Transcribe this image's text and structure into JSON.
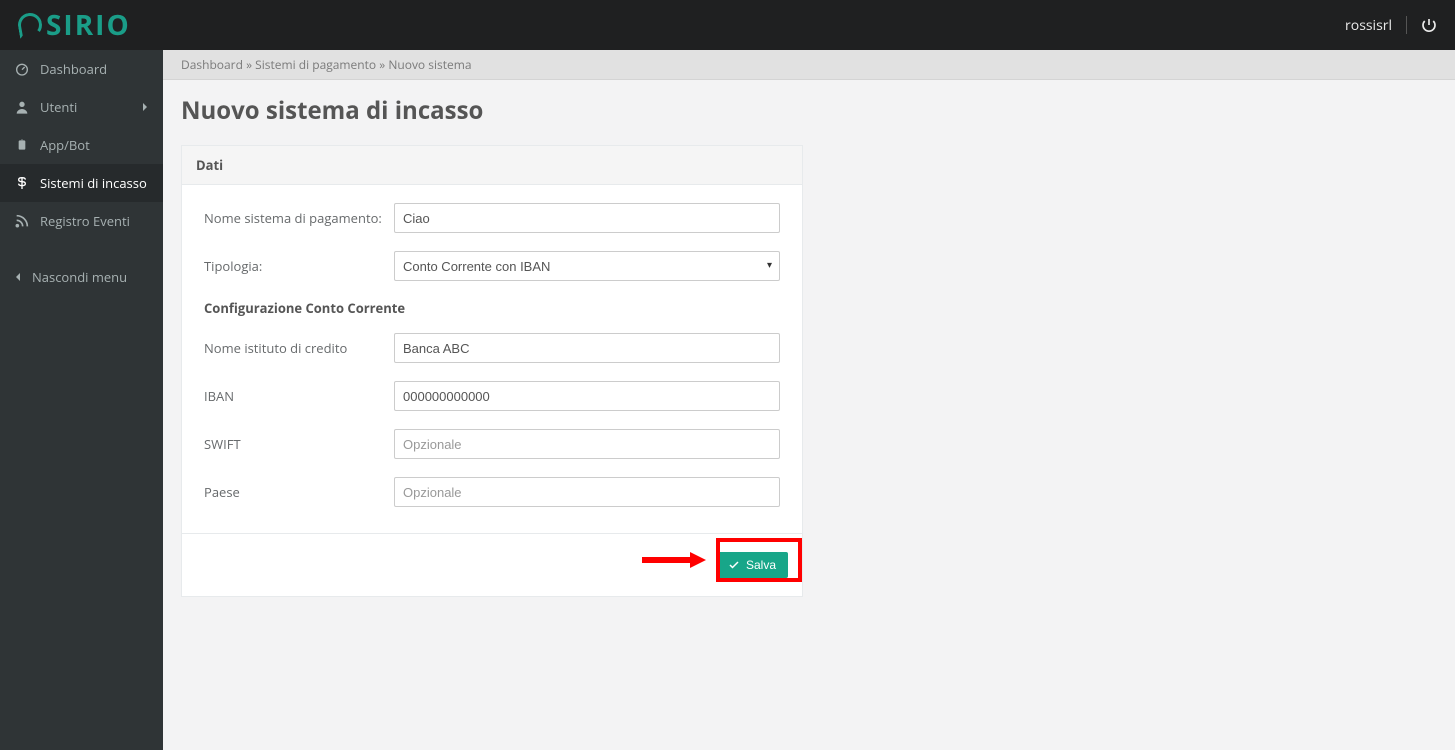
{
  "header": {
    "logo_text": "SIRIO",
    "username": "rossisrl"
  },
  "sidebar": {
    "items": [
      {
        "label": "Dashboard",
        "icon": "dashboard-icon"
      },
      {
        "label": "Utenti",
        "icon": "user-icon",
        "expandable": true
      },
      {
        "label": "App/Bot",
        "icon": "appbot-icon"
      },
      {
        "label": "Sistemi di incasso",
        "icon": "dollar-icon",
        "active": true
      },
      {
        "label": "Registro Eventi",
        "icon": "rss-icon"
      }
    ],
    "hide_label": "Nascondi menu"
  },
  "breadcrumb": {
    "part1": "Dashboard",
    "sep": " » ",
    "part2": "Sistemi di pagamento",
    "part3": "Nuovo sistema"
  },
  "page": {
    "title": "Nuovo sistema di incasso"
  },
  "form": {
    "card_title": "Dati",
    "name_label": "Nome sistema di pagamento:",
    "name_value": "Ciao",
    "type_label": "Tipologia:",
    "type_value": "Conto Corrente con IBAN",
    "section_label": "Configurazione Conto Corrente",
    "bank_label": "Nome istituto di credito",
    "bank_value": "Banca ABC",
    "iban_label": "IBAN",
    "iban_value": "000000000000",
    "swift_label": "SWIFT",
    "swift_placeholder": "Opzionale",
    "country_label": "Paese",
    "country_placeholder": "Opzionale",
    "save_label": "Salva"
  }
}
